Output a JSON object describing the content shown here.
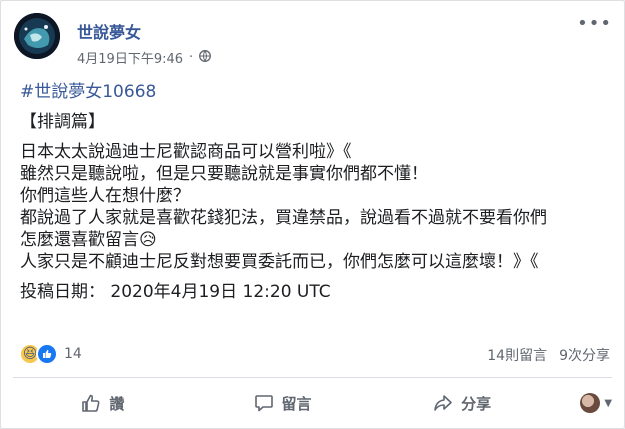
{
  "post": {
    "page_name": "世說夢女",
    "timestamp": "4月19日下午9:46",
    "separator": "·",
    "privacy_icon": "globe-icon",
    "hashtag": "#世說夢女10668",
    "lines": [
      "【排調篇】",
      "日本太太說過迪士尼歡認商品可以營利啦》《",
      "雖然只是聽說啦，但是只要聽說就是事實你們都不懂！",
      "你們這些人在想什麼？",
      "都說過了人家就是喜歡花錢犯法，買違禁品，說過看不過就不要看你們",
      "怎麼還喜歡留言😥",
      "人家只是不顧迪士尼反對想要買委託而已，你們怎麼可以這麼壞！》《"
    ],
    "submission": "投稿日期： 2020年4月19日 12:20 UTC"
  },
  "engagement": {
    "reactions": [
      "haha",
      "like"
    ],
    "reaction_count": "14",
    "comments": "14則留言",
    "shares": "9次分享"
  },
  "actions": {
    "like": "讚",
    "comment": "留言",
    "share": "分享"
  },
  "colors": {
    "link": "#385898",
    "secondary_text": "#606770",
    "like_blue": "#1877f2"
  }
}
